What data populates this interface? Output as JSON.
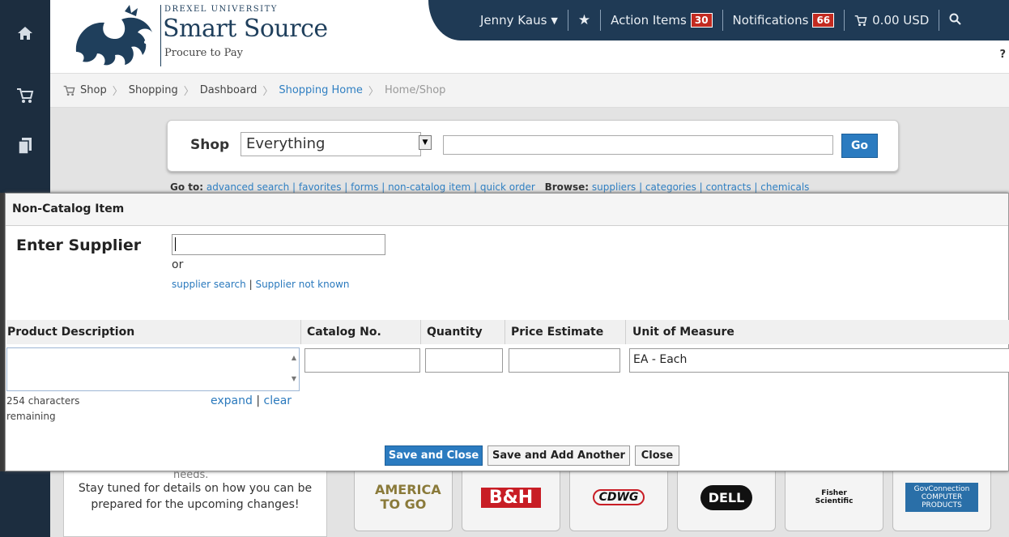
{
  "header": {
    "univ": "DREXEL UNIVERSITY",
    "title": "Smart Source",
    "subtitle": "Procure to Pay",
    "user": "Jenny Kaus",
    "action_items_label": "Action Items",
    "action_items_count": "30",
    "notifications_label": "Notifications",
    "notifications_count": "66",
    "cart_total": "0.00 USD",
    "help": "?"
  },
  "nav_icons": [
    "home-icon",
    "cart-icon",
    "documents-icon"
  ],
  "breadcrumb": [
    "Shop",
    "Shopping",
    "Dashboard",
    "Shopping Home",
    "Home/Shop"
  ],
  "shop": {
    "label": "Shop",
    "scope": "Everything",
    "go": "Go",
    "goto_prefix": "Go to:",
    "goto_links": "advanced search | favorites | forms | non-catalog item | quick order",
    "browse_prefix": "Browse:",
    "browse_links": "suppliers | categories | contracts | chemicals"
  },
  "promo": {
    "cut": "needs.",
    "text": "Stay tuned for details on how you can be prepared for the upcoming changes!"
  },
  "tiles": [
    "AMERICA TO GO",
    "B&H",
    "CDWG",
    "DELL",
    "Fisher Scientific",
    "GovConnection COMPUTER PRODUCTS"
  ],
  "modal": {
    "title": "Non-Catalog Item",
    "enter_supplier": "Enter Supplier",
    "supplier_value": "",
    "or": "or",
    "supplier_search": "supplier search",
    "supplier_not_known": "Supplier not known",
    "columns": {
      "description": "Product Description",
      "catalog": "Catalog No.",
      "quantity": "Quantity",
      "price": "Price Estimate",
      "uom": "Unit of Measure"
    },
    "uom_value": "EA - Each",
    "chars_remaining": "254 characters remaining",
    "expand": "expand",
    "clear": "clear",
    "buttons": {
      "save_close": "Save and Close",
      "save_add": "Save and Add Another",
      "close": "Close"
    }
  },
  "colors": {
    "nav": "#1c2d3f",
    "topbar": "#1f3a55",
    "accent": "#2b7bc0",
    "badge": "#c32a20"
  }
}
